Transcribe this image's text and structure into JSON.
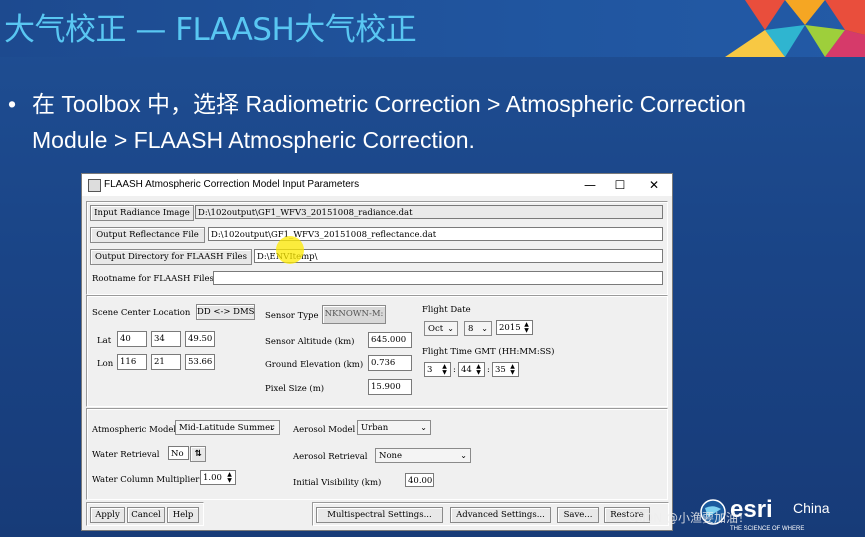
{
  "slide": {
    "title": "大气校正 — FLAASH大气校正",
    "bullet_dot": "•",
    "bullet_line1": "在 Toolbox 中，选择 Radiometric Correction > Atmospheric Correction",
    "bullet_line2": "Module > FLAASH Atmospheric Correction."
  },
  "window": {
    "title": "FLAASH Atmospheric Correction Model Input Parameters",
    "minimize": "—",
    "maximize": "☐",
    "close": "✕"
  },
  "files": {
    "input_radiance_label": "Input Radiance Image",
    "input_radiance_value": "D:\\102output\\GF1_WFV3_20151008_radiance.dat",
    "output_reflectance_label": "Output Reflectance File",
    "output_reflectance_value": "D:\\102output\\GF1_WFV3_20151008_reflectance.dat",
    "output_dir_label": "Output Directory for FLAASH Files",
    "output_dir_value": "D:\\ENVItemp\\",
    "rootname_label": "Rootname for FLAASH Files",
    "rootname_value": ""
  },
  "scene": {
    "center_label": "Scene Center Location",
    "dd_dms_button": "DD <-> DMS",
    "lat_label": "Lat",
    "lat": [
      "40",
      "34",
      "49.50"
    ],
    "lon_label": "Lon",
    "lon": [
      "116",
      "21",
      "53.66"
    ]
  },
  "sensor": {
    "type_label": "Sensor Type",
    "type_value": "NKNOWN-M:",
    "altitude_label": "Sensor Altitude (km)",
    "altitude_value": "645.000",
    "ground_label": "Ground Elevation (km)",
    "ground_value": "0.736",
    "pixel_label": "Pixel Size (m)",
    "pixel_value": "15.900"
  },
  "flight": {
    "date_label": "Flight Date",
    "month": "Oct",
    "day": "8",
    "year": "2015",
    "time_label": "Flight Time GMT (HH:MM:SS)",
    "hh": "3",
    "mm": "44",
    "ss": "35",
    "sep": ":"
  },
  "atmos": {
    "model_label": "Atmospheric Model",
    "model_value": "Mid-Latitude Summer",
    "aerosol_model_label": "Aerosol Model",
    "aerosol_model_value": "Urban",
    "water_label": "Water Retrieval",
    "water_value": "No",
    "aerosol_retrieval_label": "Aerosol Retrieval",
    "aerosol_retrieval_value": "None",
    "water_mult_label": "Water Column Multiplier",
    "water_mult_value": "1.00",
    "visibility_label": "Initial Visibility (km)",
    "visibility_value": "40.00"
  },
  "footer": {
    "apply": "Apply",
    "cancel": "Cancel",
    "help": "Help",
    "multispectral": "Multispectral Settings...",
    "advanced": "Advanced Settings...",
    "save": "Save...",
    "restore": "Restore"
  },
  "branding": {
    "logo_text": "esri",
    "logo_suffix": "China",
    "logo_tagline": "THE SCIENCE OF WHERE",
    "watermark": "CSDN @小渔要加油！"
  },
  "colors": {
    "slide_bg": "#1a4486",
    "title_color": "#59c7f2",
    "highlight": "#ffeb00"
  }
}
